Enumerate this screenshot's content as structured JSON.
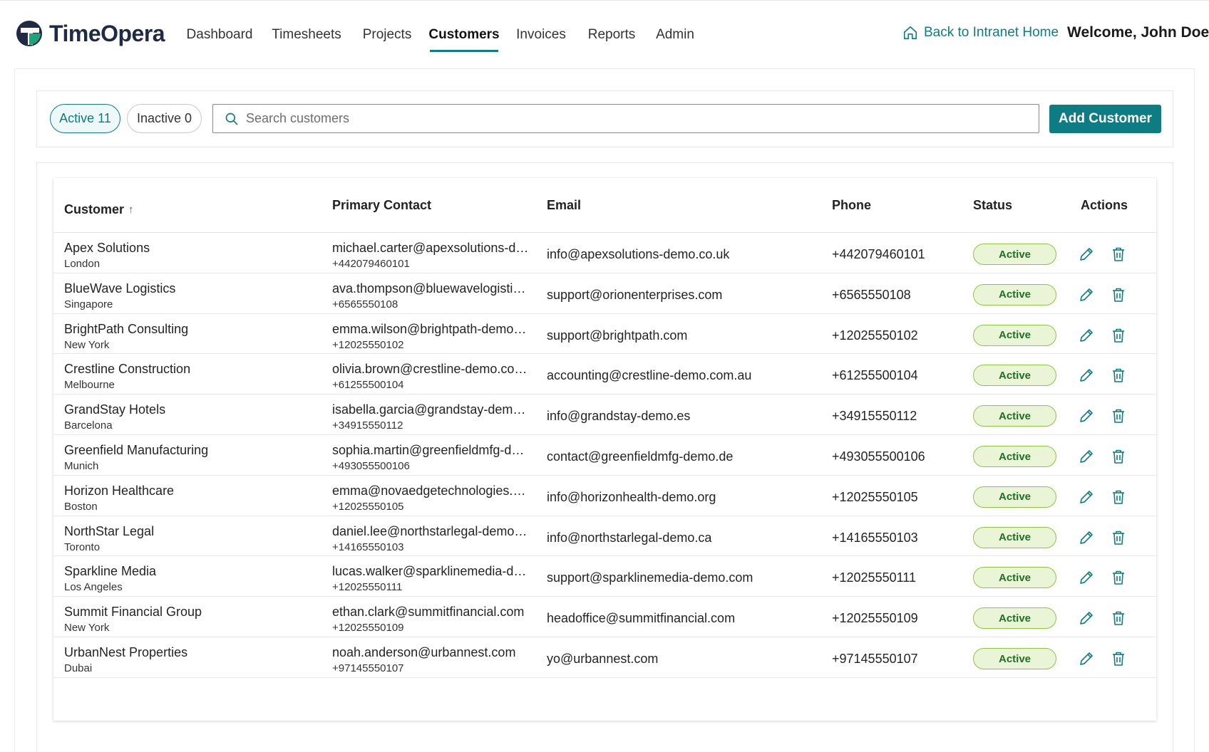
{
  "app": {
    "name": "TimeOpera"
  },
  "nav": [
    {
      "label": "Dashboard",
      "active": false
    },
    {
      "label": "Timesheets",
      "active": false
    },
    {
      "label": "Projects",
      "active": false
    },
    {
      "label": "Customers",
      "active": true
    },
    {
      "label": "Invoices",
      "active": false
    },
    {
      "label": "Reports",
      "active": false
    },
    {
      "label": "Admin",
      "active": false
    }
  ],
  "header": {
    "back_link": "Back to Intranet Home",
    "welcome": "Welcome, John Doe"
  },
  "filters": {
    "active_label": "Active 11",
    "inactive_label": "Inactive 0",
    "search_placeholder": "Search customers",
    "search_value": "",
    "add_button": "Add Customer"
  },
  "table": {
    "columns": {
      "customer": "Customer",
      "primary_contact": "Primary Contact",
      "email": "Email",
      "phone": "Phone",
      "status": "Status",
      "actions": "Actions"
    },
    "sort_indicator": "↑",
    "rows": [
      {
        "name": "Apex Solutions",
        "city": "London",
        "contact_email": "michael.carter@apexsolutions-demo.co.uk",
        "contact_phone": "+442079460101",
        "email": "info@apexsolutions-demo.co.uk",
        "phone": "+442079460101",
        "status": "Active"
      },
      {
        "name": "BlueWave Logistics",
        "city": "Singapore",
        "contact_email": "ava.thompson@bluewavelogistics-demo.sg",
        "contact_phone": "+6565550108",
        "email": "support@orionenterprises.com",
        "phone": "+6565550108",
        "status": "Active"
      },
      {
        "name": "BrightPath Consulting",
        "city": "New York",
        "contact_email": "emma.wilson@brightpath-demo.com",
        "contact_phone": "+12025550102",
        "email": "support@brightpath.com",
        "phone": "+12025550102",
        "status": "Active"
      },
      {
        "name": "Crestline Construction",
        "city": "Melbourne",
        "contact_email": "olivia.brown@crestline-demo.com.au",
        "contact_phone": "+61255500104",
        "email": "accounting@crestline-demo.com.au",
        "phone": "+61255500104",
        "status": "Active"
      },
      {
        "name": "GrandStay Hotels",
        "city": "Barcelona",
        "contact_email": "isabella.garcia@grandstay-demo.es",
        "contact_phone": "+34915550112",
        "email": "info@grandstay-demo.es",
        "phone": "+34915550112",
        "status": "Active"
      },
      {
        "name": "Greenfield Manufacturing",
        "city": "Munich",
        "contact_email": "sophia.martin@greenfieldmfg-demo.de",
        "contact_phone": "+493055500106",
        "email": "contact@greenfieldmfg-demo.de",
        "phone": "+493055500106",
        "status": "Active"
      },
      {
        "name": "Horizon Healthcare",
        "city": "Boston",
        "contact_email": "emma@novaedgetechnologies.com",
        "contact_phone": "+12025550105",
        "email": "info@horizonhealth-demo.org",
        "phone": "+12025550105",
        "status": "Active"
      },
      {
        "name": "NorthStar Legal",
        "city": "Toronto",
        "contact_email": "daniel.lee@northstarlegal-demo.ca",
        "contact_phone": "+14165550103",
        "email": "info@northstarlegal-demo.ca",
        "phone": "+14165550103",
        "status": "Active"
      },
      {
        "name": "Sparkline Media",
        "city": "Los Angeles",
        "contact_email": "lucas.walker@sparklinemedia-demo.com",
        "contact_phone": "+12025550111",
        "email": "support@sparklinemedia-demo.com",
        "phone": "+12025550111",
        "status": "Active"
      },
      {
        "name": "Summit Financial Group",
        "city": "New York",
        "contact_email": "ethan.clark@summitfinancial.com",
        "contact_phone": "+12025550109",
        "email": "headoffice@summitfinancial.com",
        "phone": "+12025550109",
        "status": "Active"
      },
      {
        "name": "UrbanNest Properties",
        "city": "Dubai",
        "contact_email": "noah.anderson@urbannest.com",
        "contact_phone": "+97145550107",
        "email": "yo@urbannest.com",
        "phone": "+97145550107",
        "status": "Active"
      }
    ]
  },
  "colors": {
    "accent": "#0e7c83",
    "badge_bg": "#e9f5d6",
    "badge_border": "#8cc63f",
    "badge_text": "#1f6f24"
  }
}
